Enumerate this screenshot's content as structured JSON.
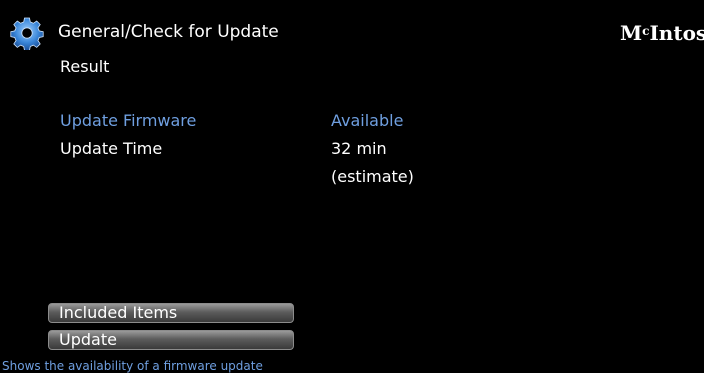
{
  "header": {
    "title": "General/Check for Update",
    "brand": {
      "lead": "M",
      "small": "c",
      "rest": "Intosh"
    }
  },
  "section": {
    "subtitle": "Result"
  },
  "info": {
    "firmware_label": "Update Firmware",
    "firmware_value": "Available",
    "time_label": "Update Time",
    "time_value": "32 min",
    "time_note": "(estimate)"
  },
  "buttons": {
    "included_items": "Included Items",
    "update": "Update"
  },
  "status_bar": {
    "text": "Shows the availability of a firmware update"
  },
  "colors": {
    "background": "#000000",
    "text": "#ffffff",
    "highlight": "#6f9fe0",
    "gear": "#4a90d9"
  },
  "icons": {
    "gear": "gear-icon"
  }
}
